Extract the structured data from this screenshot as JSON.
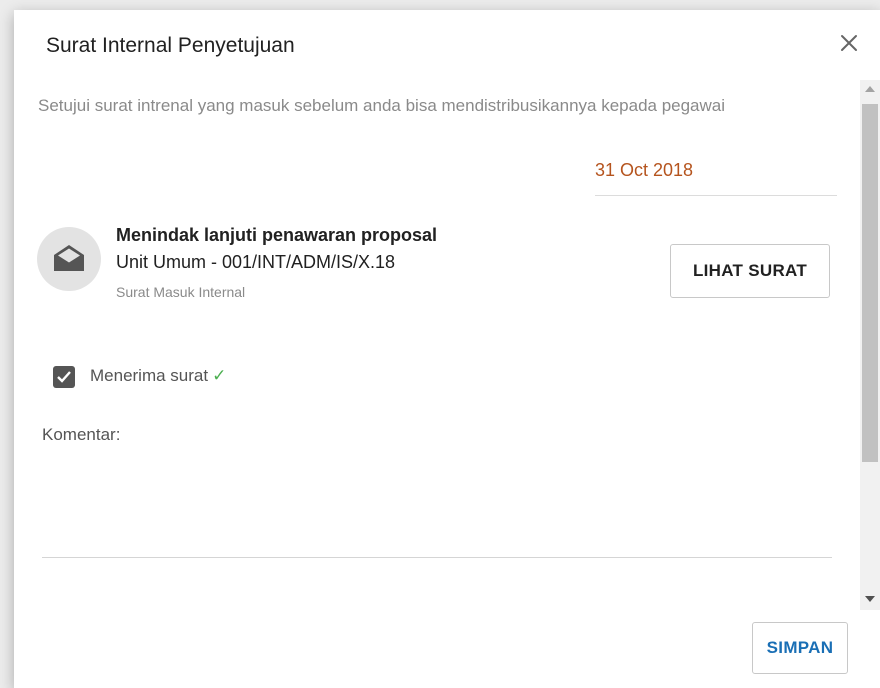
{
  "dialog": {
    "title": "Surat Internal Penyetujuan",
    "close_icon": "close-icon"
  },
  "content": {
    "subtitle": "Setujui surat intrenal yang masuk sebelum anda bisa mendistribusikannya kepada pegawai",
    "date": "31 Oct 2018",
    "letter": {
      "icon": "envelope-open-icon",
      "title": "Menindak lanjuti penawaran proposal",
      "number": "Unit Umum - 001/INT/ADM/IS/X.18",
      "type": "Surat Masuk Internal",
      "view_button_label": "LIHAT SURAT"
    },
    "accept": {
      "checked": true,
      "label": "Menerima surat",
      "status_mark": "✓"
    },
    "comment": {
      "label": "Komentar:",
      "value": ""
    }
  },
  "footer": {
    "save_button_label": "SIMPAN"
  },
  "colors": {
    "date": "#b5541e",
    "save_button_text": "#1a6fb5",
    "success_check": "#4caf50"
  }
}
